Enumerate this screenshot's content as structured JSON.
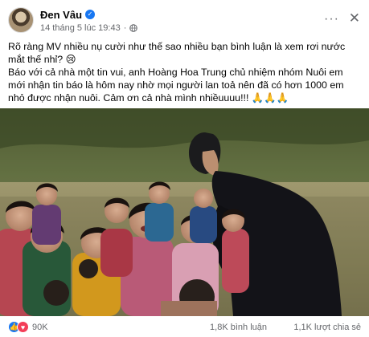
{
  "post": {
    "author": "Đen Vâu",
    "timestamp": "14 tháng 5 lúc 19:43",
    "dot": "·",
    "verified_icon": "verified-check-icon",
    "privacy_icon": "globe-icon",
    "more_label": "···",
    "close_label": "✕",
    "text_lines": [
      "Rõ ràng MV nhiều nụ cười như thế sao nhiều bạn bình luận là xem rơi nước mắt thế nhỉ? 😢",
      "Báo với cả nhà một tin vui, anh Hoàng Hoa Trung chủ nhiệm nhóm Nuôi em mới nhận tin báo là hôm nay nhờ mọi người lan toả nên đã có hơn 1000 em nhỏ được nhận nuôi. Cảm ơn cả nhà mình nhiềuuuu!!! 🙏🙏🙏"
    ],
    "photo_icon": "photo-children-and-man"
  },
  "stats": {
    "reaction_icons": [
      "like-icon",
      "love-icon"
    ],
    "like_glyph": "👍",
    "love_glyph": "♥",
    "reactions_count": "90K",
    "comments": "1,8K bình luận",
    "shares": "1,1K lượt chia sẻ"
  },
  "colors": {
    "accent": "#1877f2",
    "love": "#f33e58",
    "meta_text": "#65676b"
  }
}
